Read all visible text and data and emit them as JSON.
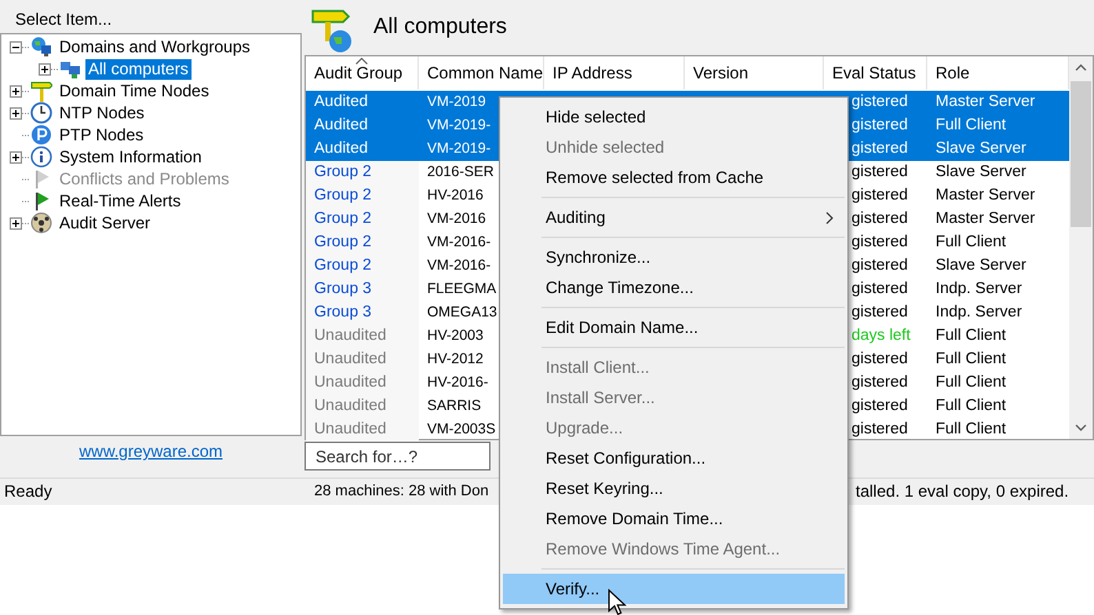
{
  "header": {
    "select_label": "Select Item...",
    "title": "All computers"
  },
  "tree": [
    {
      "label": "Domains and Workgroups",
      "kind": "domains",
      "selected": false,
      "disabled": false,
      "expanded": true,
      "children": [
        {
          "label": "All computers",
          "kind": "computers",
          "selected": true,
          "disabled": false,
          "expanded": false
        }
      ]
    },
    {
      "label": "Domain Time Nodes",
      "kind": "dtn",
      "selected": false,
      "disabled": false,
      "expanded": false
    },
    {
      "label": "NTP Nodes",
      "kind": "ntp",
      "selected": false,
      "disabled": false,
      "expanded": false
    },
    {
      "label": "PTP Nodes",
      "kind": "ptp",
      "selected": false,
      "disabled": false
    },
    {
      "label": "System Information",
      "kind": "info",
      "selected": false,
      "disabled": false,
      "expanded": false
    },
    {
      "label": "Conflicts and Problems",
      "kind": "conflicts",
      "selected": false,
      "disabled": true
    },
    {
      "label": "Real-Time Alerts",
      "kind": "alerts",
      "selected": false,
      "disabled": false
    },
    {
      "label": "Audit Server",
      "kind": "audit",
      "selected": false,
      "disabled": false,
      "expanded": false
    }
  ],
  "link": "www.greyware.com",
  "search": {
    "placeholder": "Search for…?"
  },
  "table": {
    "columns": [
      "Audit Group",
      "Common Name",
      "IP Address",
      "Version",
      "Eval Status",
      "Role"
    ],
    "rows": [
      {
        "group": "Audited",
        "kind": "audited",
        "name": "VM-2019",
        "eval": "gistered",
        "eval_expiring": false,
        "role": "Master Server",
        "selected": true
      },
      {
        "group": "Audited",
        "kind": "audited",
        "name": "VM-2019-",
        "eval": "gistered",
        "eval_expiring": false,
        "role": "Full Client",
        "selected": true
      },
      {
        "group": "Audited",
        "kind": "audited",
        "name": "VM-2019-",
        "eval": "gistered",
        "eval_expiring": false,
        "role": "Slave Server",
        "selected": true
      },
      {
        "group": "Group 2",
        "kind": "group",
        "name": "2016-SER",
        "eval": "gistered",
        "eval_expiring": false,
        "role": "Slave Server",
        "selected": false
      },
      {
        "group": "Group 2",
        "kind": "group",
        "name": "HV-2016",
        "eval": "gistered",
        "eval_expiring": false,
        "role": "Master Server",
        "selected": false
      },
      {
        "group": "Group 2",
        "kind": "group",
        "name": "VM-2016",
        "eval": "gistered",
        "eval_expiring": false,
        "role": "Master Server",
        "selected": false
      },
      {
        "group": "Group 2",
        "kind": "group",
        "name": "VM-2016-",
        "eval": "gistered",
        "eval_expiring": false,
        "role": "Full Client",
        "selected": false
      },
      {
        "group": "Group 2",
        "kind": "group",
        "name": "VM-2016-",
        "eval": "gistered",
        "eval_expiring": false,
        "role": "Slave Server",
        "selected": false
      },
      {
        "group": "Group 3",
        "kind": "group",
        "name": "FLEEGMA",
        "eval": "gistered",
        "eval_expiring": false,
        "role": "Indp. Server",
        "selected": false
      },
      {
        "group": "Group 3",
        "kind": "group",
        "name": "OMEGA13",
        "eval": "gistered",
        "eval_expiring": false,
        "role": "Indp. Server",
        "selected": false
      },
      {
        "group": "Unaudited",
        "kind": "unaudited",
        "name": "HV-2003",
        "eval": "days left",
        "eval_expiring": true,
        "role": "Full Client",
        "selected": false
      },
      {
        "group": "Unaudited",
        "kind": "unaudited",
        "name": "HV-2012",
        "eval": "gistered",
        "eval_expiring": false,
        "role": "Full Client",
        "selected": false
      },
      {
        "group": "Unaudited",
        "kind": "unaudited",
        "name": "HV-2016-",
        "eval": "gistered",
        "eval_expiring": false,
        "role": "Full Client",
        "selected": false
      },
      {
        "group": "Unaudited",
        "kind": "unaudited",
        "name": "SARRIS",
        "eval": "gistered",
        "eval_expiring": false,
        "role": "Full Client",
        "selected": false
      },
      {
        "group": "Unaudited",
        "kind": "unaudited",
        "name": "VM-2003S",
        "eval": "gistered",
        "eval_expiring": false,
        "role": "Full Client",
        "selected": false
      }
    ]
  },
  "status_bar": {
    "left": "Ready",
    "parts": [
      "28 machines: 28 with Don",
      "talled. 1 eval copy, 0 expired."
    ]
  },
  "context_menu": [
    {
      "kind": "item",
      "label": "Hide selected",
      "disabled": false,
      "selected": false
    },
    {
      "kind": "item",
      "label": "Unhide selected",
      "disabled": true,
      "selected": false
    },
    {
      "kind": "item",
      "label": "Remove selected from Cache",
      "disabled": false,
      "selected": false
    },
    {
      "kind": "separator"
    },
    {
      "kind": "item",
      "label": "Auditing",
      "disabled": false,
      "selected": false,
      "submenu": true
    },
    {
      "kind": "separator"
    },
    {
      "kind": "item",
      "label": "Synchronize...",
      "disabled": false,
      "selected": false
    },
    {
      "kind": "item",
      "label": "Change Timezone...",
      "disabled": false,
      "selected": false
    },
    {
      "kind": "separator"
    },
    {
      "kind": "item",
      "label": "Edit Domain Name...",
      "disabled": false,
      "selected": false
    },
    {
      "kind": "separator"
    },
    {
      "kind": "item",
      "label": "Install Client...",
      "disabled": true,
      "selected": false
    },
    {
      "kind": "item",
      "label": "Install Server...",
      "disabled": true,
      "selected": false
    },
    {
      "kind": "item",
      "label": "Upgrade...",
      "disabled": true,
      "selected": false
    },
    {
      "kind": "item",
      "label": "Reset Configuration...",
      "disabled": false,
      "selected": false
    },
    {
      "kind": "item",
      "label": "Reset Keyring...",
      "disabled": false,
      "selected": false
    },
    {
      "kind": "item",
      "label": "Remove Domain Time...",
      "disabled": false,
      "selected": false
    },
    {
      "kind": "item",
      "label": "Remove Windows Time Agent...",
      "disabled": true,
      "selected": false
    },
    {
      "kind": "separator"
    },
    {
      "kind": "item",
      "label": "Verify...",
      "disabled": false,
      "selected": true
    }
  ]
}
